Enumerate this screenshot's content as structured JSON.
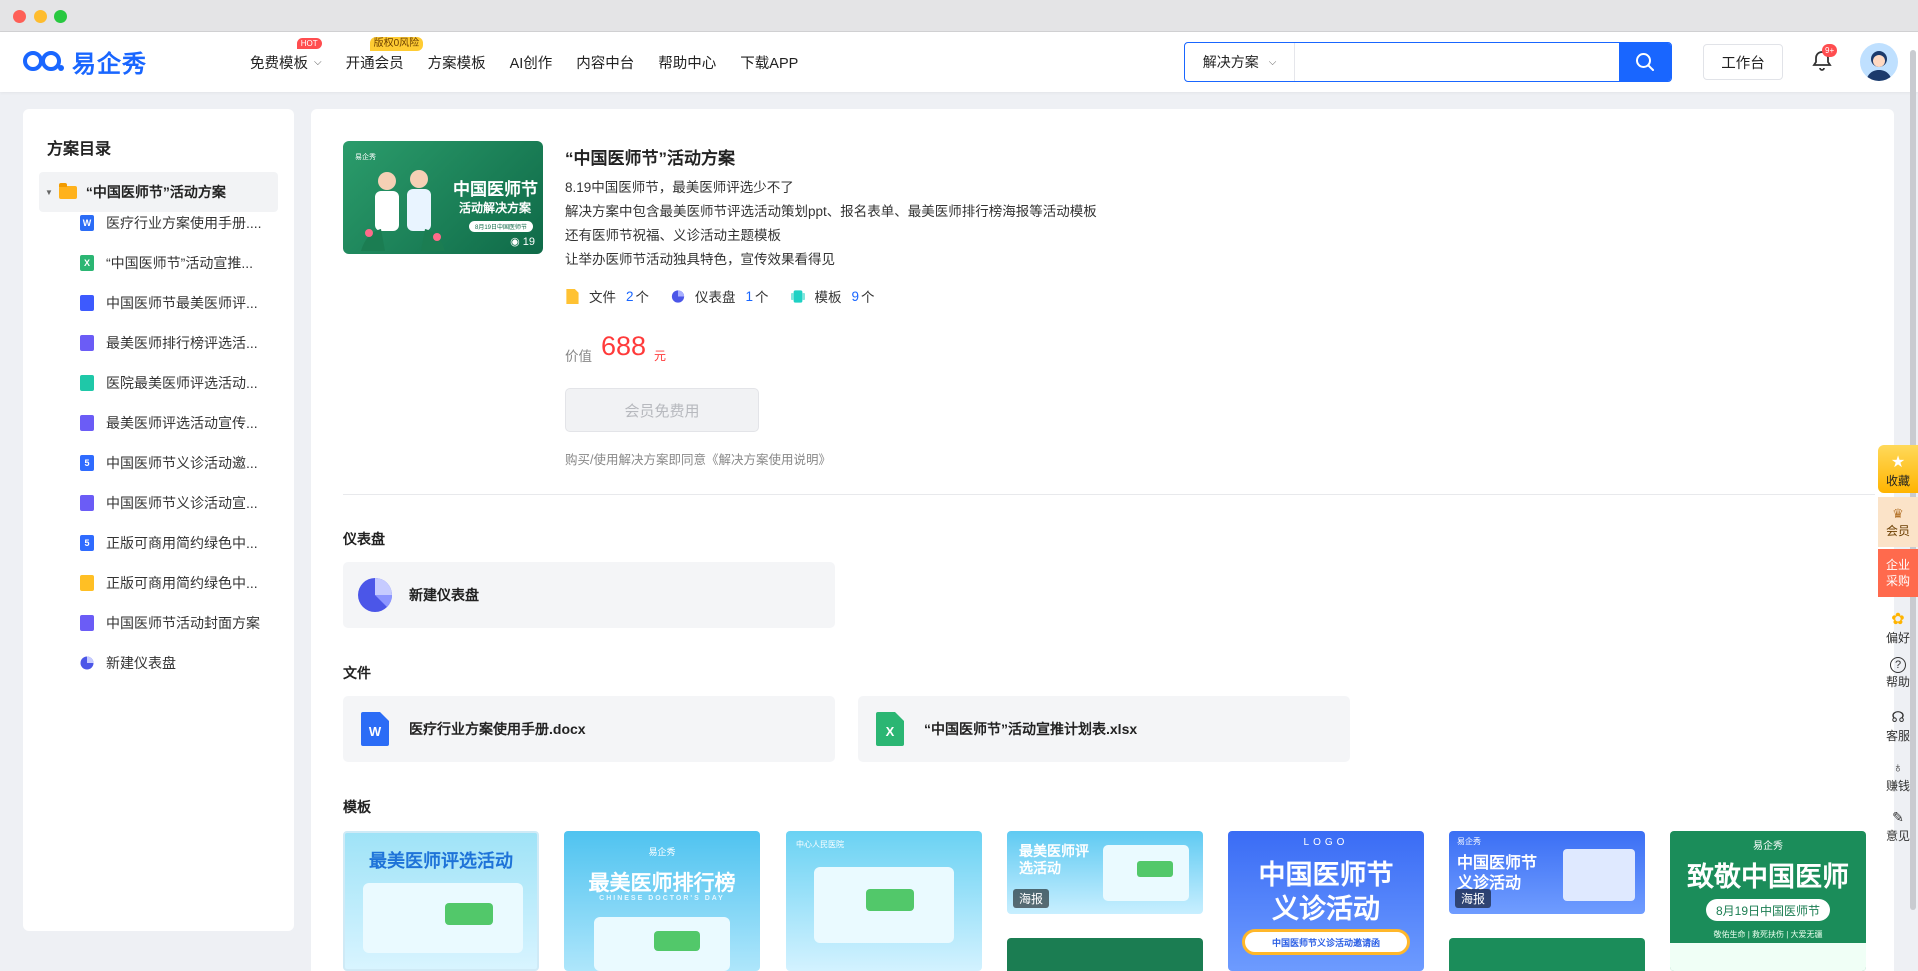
{
  "nav": {
    "logo_text": "易企秀",
    "items": [
      {
        "label": "免费模板",
        "badge": "HOT"
      },
      {
        "label": "开通会员",
        "badge": "版权0风险"
      },
      {
        "label": "方案模板"
      },
      {
        "label": "AI创作"
      },
      {
        "label": "内容中台"
      },
      {
        "label": "帮助中心"
      },
      {
        "label": "下载APP"
      }
    ],
    "search": {
      "category": "解决方案",
      "value": "",
      "placeholder": ""
    },
    "workbench_label": "工作台",
    "notification_badge": "9+"
  },
  "sidebar": {
    "title": "方案目录",
    "root": "“中国医师节”活动方案",
    "items": [
      {
        "label": "医疗行业方案使用手册....",
        "icon": "word-icon",
        "type": "word",
        "glyph": "W"
      },
      {
        "label": "“中国医师节”活动宣推...",
        "icon": "excel-icon",
        "type": "excel",
        "glyph": "X"
      },
      {
        "label": "中国医师节最美医师评...",
        "icon": "book-icon",
        "type": "book",
        "glyph": ""
      },
      {
        "label": "最美医师排行榜评选活...",
        "icon": "image-icon",
        "type": "img",
        "glyph": ""
      },
      {
        "label": "医院最美医师评选活动...",
        "icon": "form-icon",
        "type": "form",
        "glyph": ""
      },
      {
        "label": "最美医师评选活动宣传...",
        "icon": "image-icon",
        "type": "img",
        "glyph": ""
      },
      {
        "label": "中国医师节义诊活动邀...",
        "icon": "h5-icon",
        "type": "h5",
        "glyph": "5"
      },
      {
        "label": "中国医师节义诊活动宣...",
        "icon": "image-icon",
        "type": "img",
        "glyph": ""
      },
      {
        "label": "正版可商用简约绿色中...",
        "icon": "h5-icon",
        "type": "h5",
        "glyph": "5"
      },
      {
        "label": "正版可商用简约绿色中...",
        "icon": "doc-icon",
        "type": "doc",
        "glyph": ""
      },
      {
        "label": "中国医师节活动封面方案",
        "icon": "image-icon",
        "type": "img",
        "glyph": ""
      },
      {
        "label": "新建仪表盘",
        "icon": "dashboard-icon",
        "type": "dash",
        "glyph": ""
      }
    ]
  },
  "plan": {
    "cover": {
      "title": "中国医师节",
      "subtitle": "活动解决方案",
      "date": "8月19日中国医师节",
      "views": "19",
      "logo": "易企秀"
    },
    "title": "“中国医师节”活动方案",
    "desc_lines": [
      "8.19中国医师节，最美医师评选少不了",
      "解决方案中包含最美医师节评选活动策划ppt、报名表单、最美医师排行榜海报等活动模板",
      "还有医师节祝福、义诊活动主题模板",
      "让举办医师节活动独具特色，宣传效果看得见"
    ],
    "stats": [
      {
        "label": "文件",
        "count": "2",
        "unit": "个"
      },
      {
        "label": "仪表盘",
        "count": "1",
        "unit": "个"
      },
      {
        "label": "模板",
        "count": "9",
        "unit": "个"
      }
    ],
    "price_label": "价值",
    "price": "688",
    "price_unit": "元",
    "button_label": "会员免费用",
    "agreement": "购买/使用解决方案即同意《解决方案使用说明》"
  },
  "sections": {
    "dashboard": {
      "title": "仪表盘",
      "items": [
        "新建仪表盘"
      ]
    },
    "files": {
      "title": "文件",
      "items": [
        "医疗行业方案使用手册.docx",
        "“中国医师节”活动宣推计划表.xlsx"
      ]
    },
    "templates": {
      "title": "模板",
      "items": [
        {
          "text": "最美医师评选活动",
          "tag": ""
        },
        {
          "text": "最美医师排行榜",
          "sub": "CHINESE DOCTOR'S DAY",
          "logo": "易企秀",
          "tag": ""
        },
        {
          "text": "中心人民医院",
          "tag": ""
        },
        {
          "text": "最美医师评选活动",
          "tag": "海报"
        },
        {
          "text": "中国医师节",
          "text2": "义诊活动",
          "logo": "LOGO",
          "sub": "中国医师节义诊活动邀请函",
          "tag": ""
        },
        {
          "text": "中国医师节",
          "text2": "义诊活动",
          "logo": "易企秀",
          "tag": "海报"
        },
        {
          "text": "致敬中国医师",
          "sub": "8月19日中国医师节",
          "sub2": "敬佑生命 | 救死扶伤 | 大爱无疆",
          "logo": "易企秀",
          "tag": ""
        }
      ]
    }
  },
  "right_rail": [
    "收藏",
    "会员",
    "企业采购",
    "偏好",
    "帮助",
    "客服",
    "赚钱",
    "意见"
  ],
  "colors": {
    "brand": "#1966ff",
    "price": "#ff3a3a",
    "green": "#16855a"
  }
}
